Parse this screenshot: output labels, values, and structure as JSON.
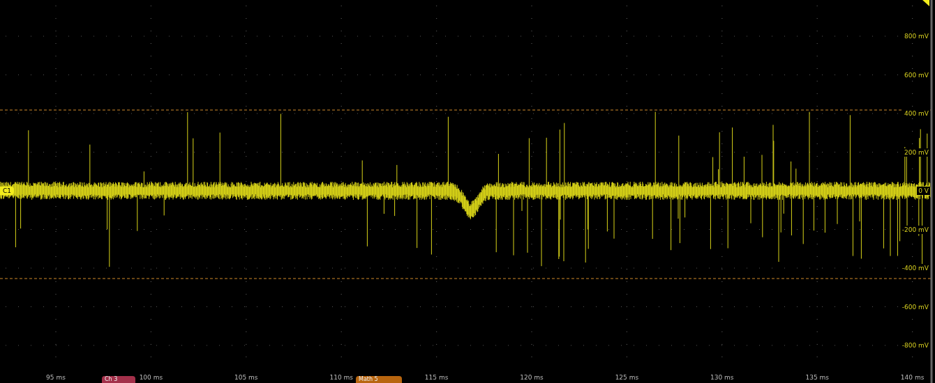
{
  "plot": {
    "trace_label": "C1",
    "trigger_marker": true,
    "y_axis_labels": [
      "800 mV",
      "600 mV",
      "400 mV",
      "200 mV",
      "0 V",
      "-200 mV",
      "-400 mV",
      "-600 mV",
      "-800 mV"
    ],
    "x_axis_labels": [
      "95 ms",
      "100 ms",
      "105 ms",
      "110 ms",
      "115 ms",
      "120 ms",
      "125 ms",
      "130 ms",
      "135 ms",
      "140 ms"
    ]
  },
  "badges": [
    {
      "label": "Ch 3",
      "color": "#a3304a"
    },
    {
      "label": "Math 5",
      "color": "#b8650f"
    }
  ]
}
